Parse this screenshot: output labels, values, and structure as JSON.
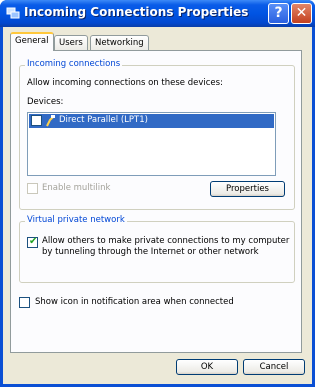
{
  "window": {
    "title": "Incoming Connections Properties",
    "help_glyph": "?",
    "close_glyph": "✕"
  },
  "tabs": [
    {
      "label": "General",
      "active": true
    },
    {
      "label": "Users",
      "active": false
    },
    {
      "label": "Networking",
      "active": false
    }
  ],
  "incoming": {
    "group_label": "Incoming connections",
    "description": "Allow incoming connections on these devices:",
    "devices_label": "Devices:",
    "devices": [
      {
        "label": "Direct Parallel (LPT1)",
        "checked": false,
        "selected": true
      }
    ],
    "multilink_label": "Enable multilink",
    "multilink_enabled": false,
    "properties_button": "Properties"
  },
  "vpn": {
    "group_label": "Virtual private network",
    "allow_line1": "Allow others to make private connections to my computer",
    "allow_line2": "by tunneling through the Internet or other network",
    "allow_checked": true
  },
  "notify": {
    "label": "Show icon in notification area when connected",
    "checked": false
  },
  "buttons": {
    "ok": "OK",
    "cancel": "Cancel"
  },
  "colors": {
    "title_blue": "#0054e3",
    "selection": "#316ac5",
    "group_label": "#0046d5",
    "dialog_bg": "#ece9d8"
  }
}
